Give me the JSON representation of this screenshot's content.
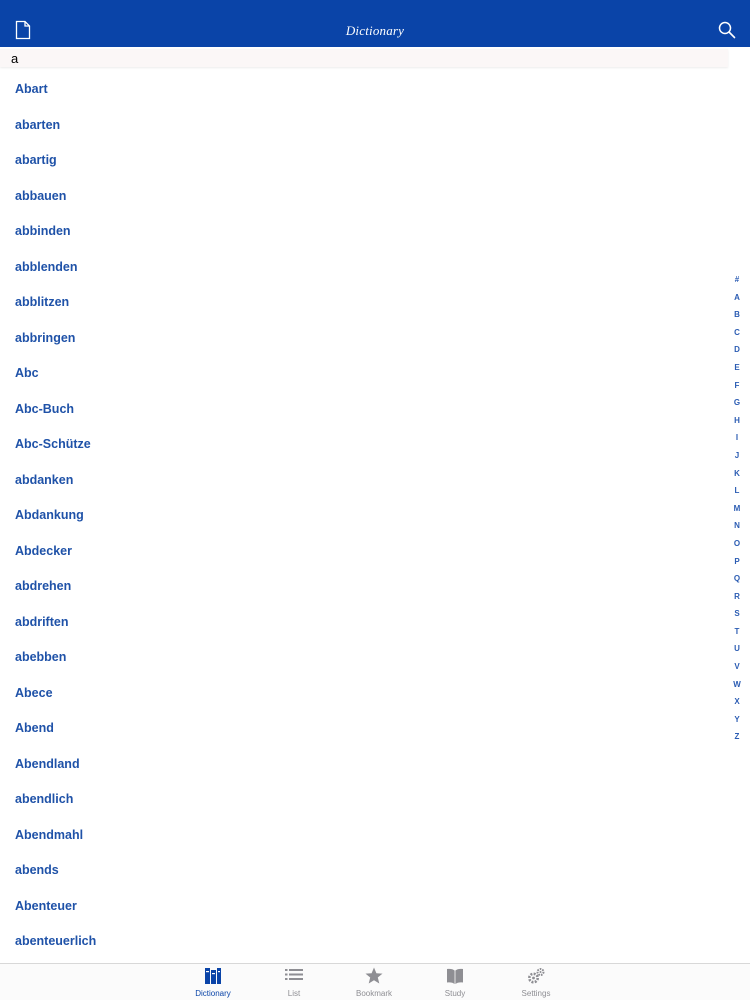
{
  "header": {
    "title": "Dictionary",
    "left_icon": "document-icon",
    "right_icon": "search-icon",
    "background_color": "#0a44a8"
  },
  "search": {
    "value": "a"
  },
  "words": [
    "Abart",
    "abarten",
    "abartig",
    "abbauen",
    "abbinden",
    "abblenden",
    "abblitzen",
    "abbringen",
    "Abc",
    "Abc-Buch",
    "Abc-Schütze",
    "abdanken",
    "Abdankung",
    "Abdecker",
    "abdrehen",
    "abdriften",
    "abebben",
    "Abece",
    "Abend",
    "Abendland",
    "abendlich",
    "Abendmahl",
    "abends",
    "Abenteuer",
    "abenteuerlich"
  ],
  "word_color": "#1f52a8",
  "index_letters": [
    "#",
    "A",
    "B",
    "C",
    "D",
    "E",
    "F",
    "G",
    "H",
    "I",
    "J",
    "K",
    "L",
    "M",
    "N",
    "O",
    "P",
    "Q",
    "R",
    "S",
    "T",
    "U",
    "V",
    "W",
    "X",
    "Y",
    "Z"
  ],
  "tabs": [
    {
      "label": "Dictionary",
      "icon": "dictionary-books-icon",
      "active": true
    },
    {
      "label": "List",
      "icon": "list-icon",
      "active": false
    },
    {
      "label": "Bookmark",
      "icon": "star-icon",
      "active": false
    },
    {
      "label": "Study",
      "icon": "open-book-icon",
      "active": false
    },
    {
      "label": "Settings",
      "icon": "gears-icon",
      "active": false
    }
  ]
}
